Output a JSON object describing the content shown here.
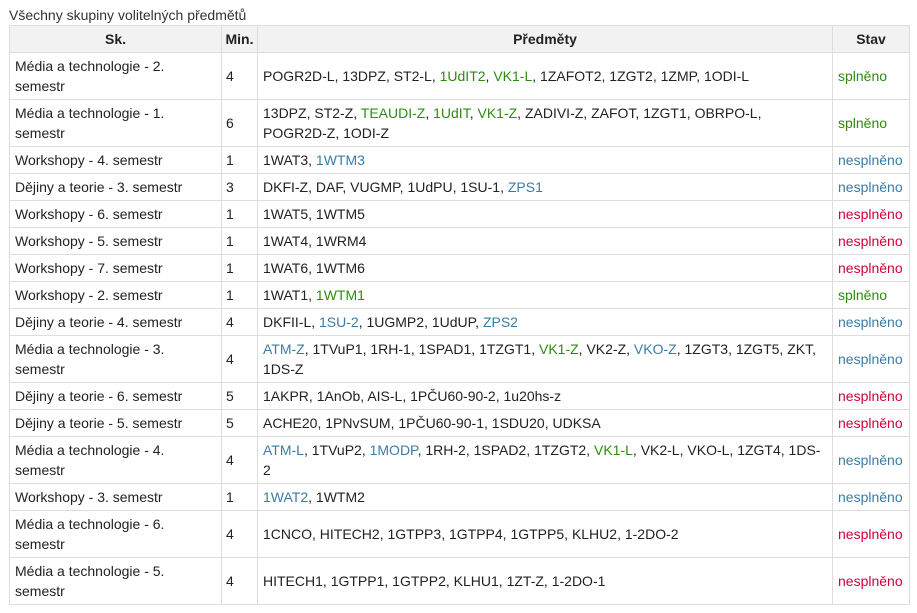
{
  "caption": "Všechny skupiny volitelných předmětů",
  "headers": {
    "sk": "Sk.",
    "min": "Min.",
    "predmety": "Předměty",
    "stav": "Stav"
  },
  "colors": {
    "green": "#2e8b10",
    "blue": "#3a7ca5",
    "red": "#d0023a"
  },
  "rows": [
    {
      "sk": "Média a technologie - 2. semestr",
      "min": "4",
      "stav": "splněno",
      "stav_color": "green",
      "courses": [
        {
          "t": "POGR2D-L"
        },
        {
          "t": "13DPZ"
        },
        {
          "t": "ST2-L"
        },
        {
          "t": "1UdIT2",
          "c": "green"
        },
        {
          "t": "VK1-L",
          "c": "green"
        },
        {
          "t": "1ZAFOT2"
        },
        {
          "t": "1ZGT2"
        },
        {
          "t": "1ZMP"
        },
        {
          "t": "1ODI-L"
        }
      ]
    },
    {
      "sk": "Média a technologie - 1. semestr",
      "min": "6",
      "stav": "splněno",
      "stav_color": "green",
      "courses": [
        {
          "t": "13DPZ"
        },
        {
          "t": "ST2-Z"
        },
        {
          "t": "TEAUDI-Z",
          "c": "green"
        },
        {
          "t": "1UdIT",
          "c": "green"
        },
        {
          "t": "VK1-Z",
          "c": "green"
        },
        {
          "t": "ZADIVI-Z"
        },
        {
          "t": "ZAFOT"
        },
        {
          "t": "1ZGT1"
        },
        {
          "t": "OBRPO-L"
        },
        {
          "t": "POGR2D-Z"
        },
        {
          "t": "1ODI-Z"
        }
      ]
    },
    {
      "sk": "Workshopy - 4. semestr",
      "min": "1",
      "stav": "nesplněno",
      "stav_color": "blue",
      "courses": [
        {
          "t": "1WAT3"
        },
        {
          "t": "1WTM3",
          "c": "blue"
        }
      ]
    },
    {
      "sk": "Dějiny a teorie - 3. semestr",
      "min": "3",
      "stav": "nesplněno",
      "stav_color": "blue",
      "courses": [
        {
          "t": "DKFI-Z"
        },
        {
          "t": "DAF"
        },
        {
          "t": "VUGMP"
        },
        {
          "t": "1UdPU"
        },
        {
          "t": "1SU-1"
        },
        {
          "t": "ZPS1",
          "c": "blue"
        }
      ]
    },
    {
      "sk": "Workshopy - 6. semestr",
      "min": "1",
      "stav": "nesplněno",
      "stav_color": "red",
      "courses": [
        {
          "t": "1WAT5"
        },
        {
          "t": "1WTM5"
        }
      ]
    },
    {
      "sk": "Workshopy - 5. semestr",
      "min": "1",
      "stav": "nesplněno",
      "stav_color": "red",
      "courses": [
        {
          "t": "1WAT4"
        },
        {
          "t": "1WRM4"
        }
      ]
    },
    {
      "sk": "Workshopy - 7. semestr",
      "min": "1",
      "stav": "nesplněno",
      "stav_color": "red",
      "courses": [
        {
          "t": "1WAT6"
        },
        {
          "t": "1WTM6"
        }
      ]
    },
    {
      "sk": "Workshopy - 2. semestr",
      "min": "1",
      "stav": "splněno",
      "stav_color": "green",
      "courses": [
        {
          "t": "1WAT1"
        },
        {
          "t": "1WTM1",
          "c": "green"
        }
      ]
    },
    {
      "sk": "Dějiny a teorie - 4. semestr",
      "min": "4",
      "stav": "nesplněno",
      "stav_color": "blue",
      "courses": [
        {
          "t": "DKFII-L"
        },
        {
          "t": "1SU-2",
          "c": "blue"
        },
        {
          "t": "1UGMP2"
        },
        {
          "t": "1UdUP"
        },
        {
          "t": "ZPS2",
          "c": "blue"
        }
      ]
    },
    {
      "sk": "Média a technologie - 3. semestr",
      "min": "4",
      "stav": "nesplněno",
      "stav_color": "blue",
      "courses": [
        {
          "t": "ATM-Z",
          "c": "blue"
        },
        {
          "t": "1TVuP1"
        },
        {
          "t": "1RH-1"
        },
        {
          "t": "1SPAD1"
        },
        {
          "t": "1TZGT1"
        },
        {
          "t": "VK1-Z",
          "c": "green"
        },
        {
          "t": "VK2-Z"
        },
        {
          "t": "VKO-Z",
          "c": "blue"
        },
        {
          "t": "1ZGT3"
        },
        {
          "t": "1ZGT5"
        },
        {
          "t": "ZKT"
        },
        {
          "t": "1DS-Z"
        }
      ]
    },
    {
      "sk": "Dějiny a teorie - 6. semestr",
      "min": "5",
      "stav": "nesplněno",
      "stav_color": "red",
      "courses": [
        {
          "t": "1AKPR"
        },
        {
          "t": "1AnOb"
        },
        {
          "t": "AIS-L"
        },
        {
          "t": "1PČU60-90-2"
        },
        {
          "t": "1u20hs-z"
        }
      ]
    },
    {
      "sk": "Dějiny a teorie - 5. semestr",
      "min": "5",
      "stav": "nesplněno",
      "stav_color": "red",
      "courses": [
        {
          "t": "ACHE20"
        },
        {
          "t": "1PNvSUM"
        },
        {
          "t": "1PČU60-90-1"
        },
        {
          "t": "1SDU20"
        },
        {
          "t": "UDKSA"
        }
      ]
    },
    {
      "sk": "Média a technologie - 4. semestr",
      "min": "4",
      "stav": "nesplněno",
      "stav_color": "blue",
      "courses": [
        {
          "t": "ATM-L",
          "c": "blue"
        },
        {
          "t": "1TVuP2"
        },
        {
          "t": "1MODP",
          "c": "blue"
        },
        {
          "t": "1RH-2"
        },
        {
          "t": "1SPAD2"
        },
        {
          "t": "1TZGT2"
        },
        {
          "t": "VK1-L",
          "c": "green"
        },
        {
          "t": "VK2-L"
        },
        {
          "t": "VKO-L"
        },
        {
          "t": "1ZGT4"
        },
        {
          "t": "1DS-2"
        }
      ]
    },
    {
      "sk": "Workshopy - 3. semestr",
      "min": "1",
      "stav": "nesplněno",
      "stav_color": "blue",
      "courses": [
        {
          "t": "1WAT2",
          "c": "blue"
        },
        {
          "t": "1WTM2"
        }
      ]
    },
    {
      "sk": "Média a technologie - 6. semestr",
      "min": "4",
      "stav": "nesplněno",
      "stav_color": "red",
      "courses": [
        {
          "t": "1CNCO"
        },
        {
          "t": "HITECH2"
        },
        {
          "t": "1GTPP3"
        },
        {
          "t": "1GTPP4"
        },
        {
          "t": "1GTPP5"
        },
        {
          "t": "KLHU2"
        },
        {
          "t": "1-2DO-2"
        }
      ]
    },
    {
      "sk": "Média a technologie - 5. semestr",
      "min": "4",
      "stav": "nesplněno",
      "stav_color": "red",
      "courses": [
        {
          "t": "HITECH1"
        },
        {
          "t": "1GTPP1"
        },
        {
          "t": "1GTPP2"
        },
        {
          "t": "KLHU1"
        },
        {
          "t": "1ZT-Z"
        },
        {
          "t": "1-2DO-1"
        }
      ]
    }
  ]
}
